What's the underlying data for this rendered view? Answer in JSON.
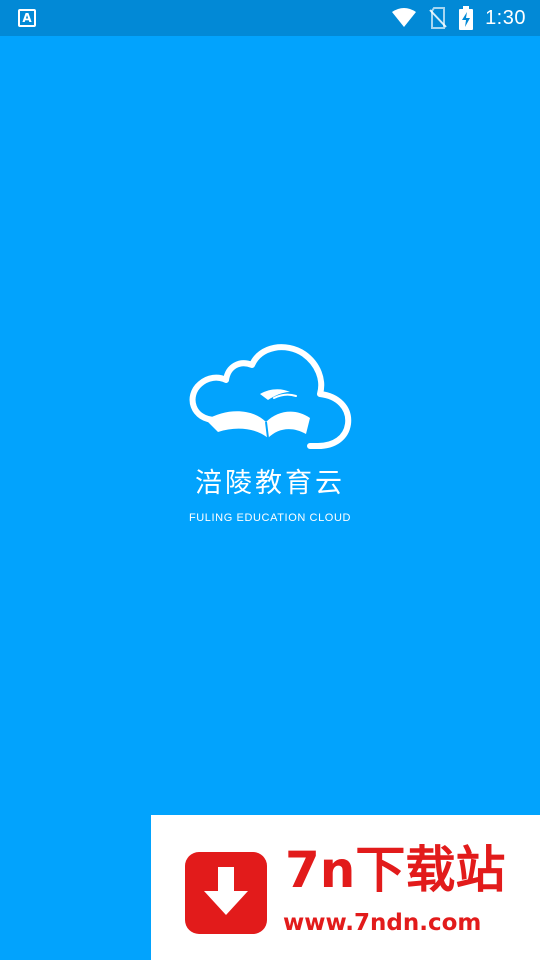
{
  "status_bar": {
    "notification_icon": "app-a-icon",
    "notification_glyph": "A",
    "time": "1:30",
    "icons": [
      "wifi-icon",
      "no-sim-icon",
      "battery-charging-icon"
    ]
  },
  "splash": {
    "logo_icon": "cloud-book-icon",
    "title": "涪陵教育云",
    "subtitle": "FULING EDUCATION CLOUD",
    "background_color": "#02a3fd"
  },
  "watermark": {
    "icon": "download-arrow-icon",
    "brand": "7n下载站",
    "url": "www.7ndn.com",
    "accent_color": "#e21b1b"
  }
}
